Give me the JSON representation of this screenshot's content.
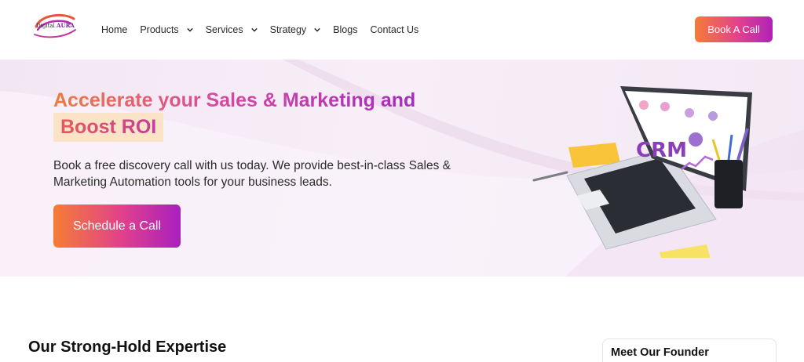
{
  "logo": {
    "prefix": "Digital",
    "brand": "AURA"
  },
  "nav": {
    "items": [
      {
        "label": "Home",
        "dropdown": false
      },
      {
        "label": "Products",
        "dropdown": true
      },
      {
        "label": "Services",
        "dropdown": true
      },
      {
        "label": "Strategy",
        "dropdown": true
      },
      {
        "label": "Blogs",
        "dropdown": false
      },
      {
        "label": "Contact Us",
        "dropdown": false
      }
    ]
  },
  "header": {
    "cta_label": "Book A Call"
  },
  "hero": {
    "headline_line1": "Accelerate your Sales & Marketing and",
    "headline_line2": "Boost ROI",
    "subtext": "Book a free discovery call with us today. We provide best-in-class Sales & Marketing Automation tools for your business leads.",
    "cta_label": "Schedule a Call",
    "illustration_text": "CRM"
  },
  "expertise": {
    "title": "Our Strong-Hold Expertise"
  },
  "founder": {
    "title": "Meet Our Founder"
  },
  "colors": {
    "accent_orange": "#f57c38",
    "accent_magenta": "#e2428a",
    "accent_purple": "#b022b8",
    "hero_bg": "#f5ebf5"
  }
}
